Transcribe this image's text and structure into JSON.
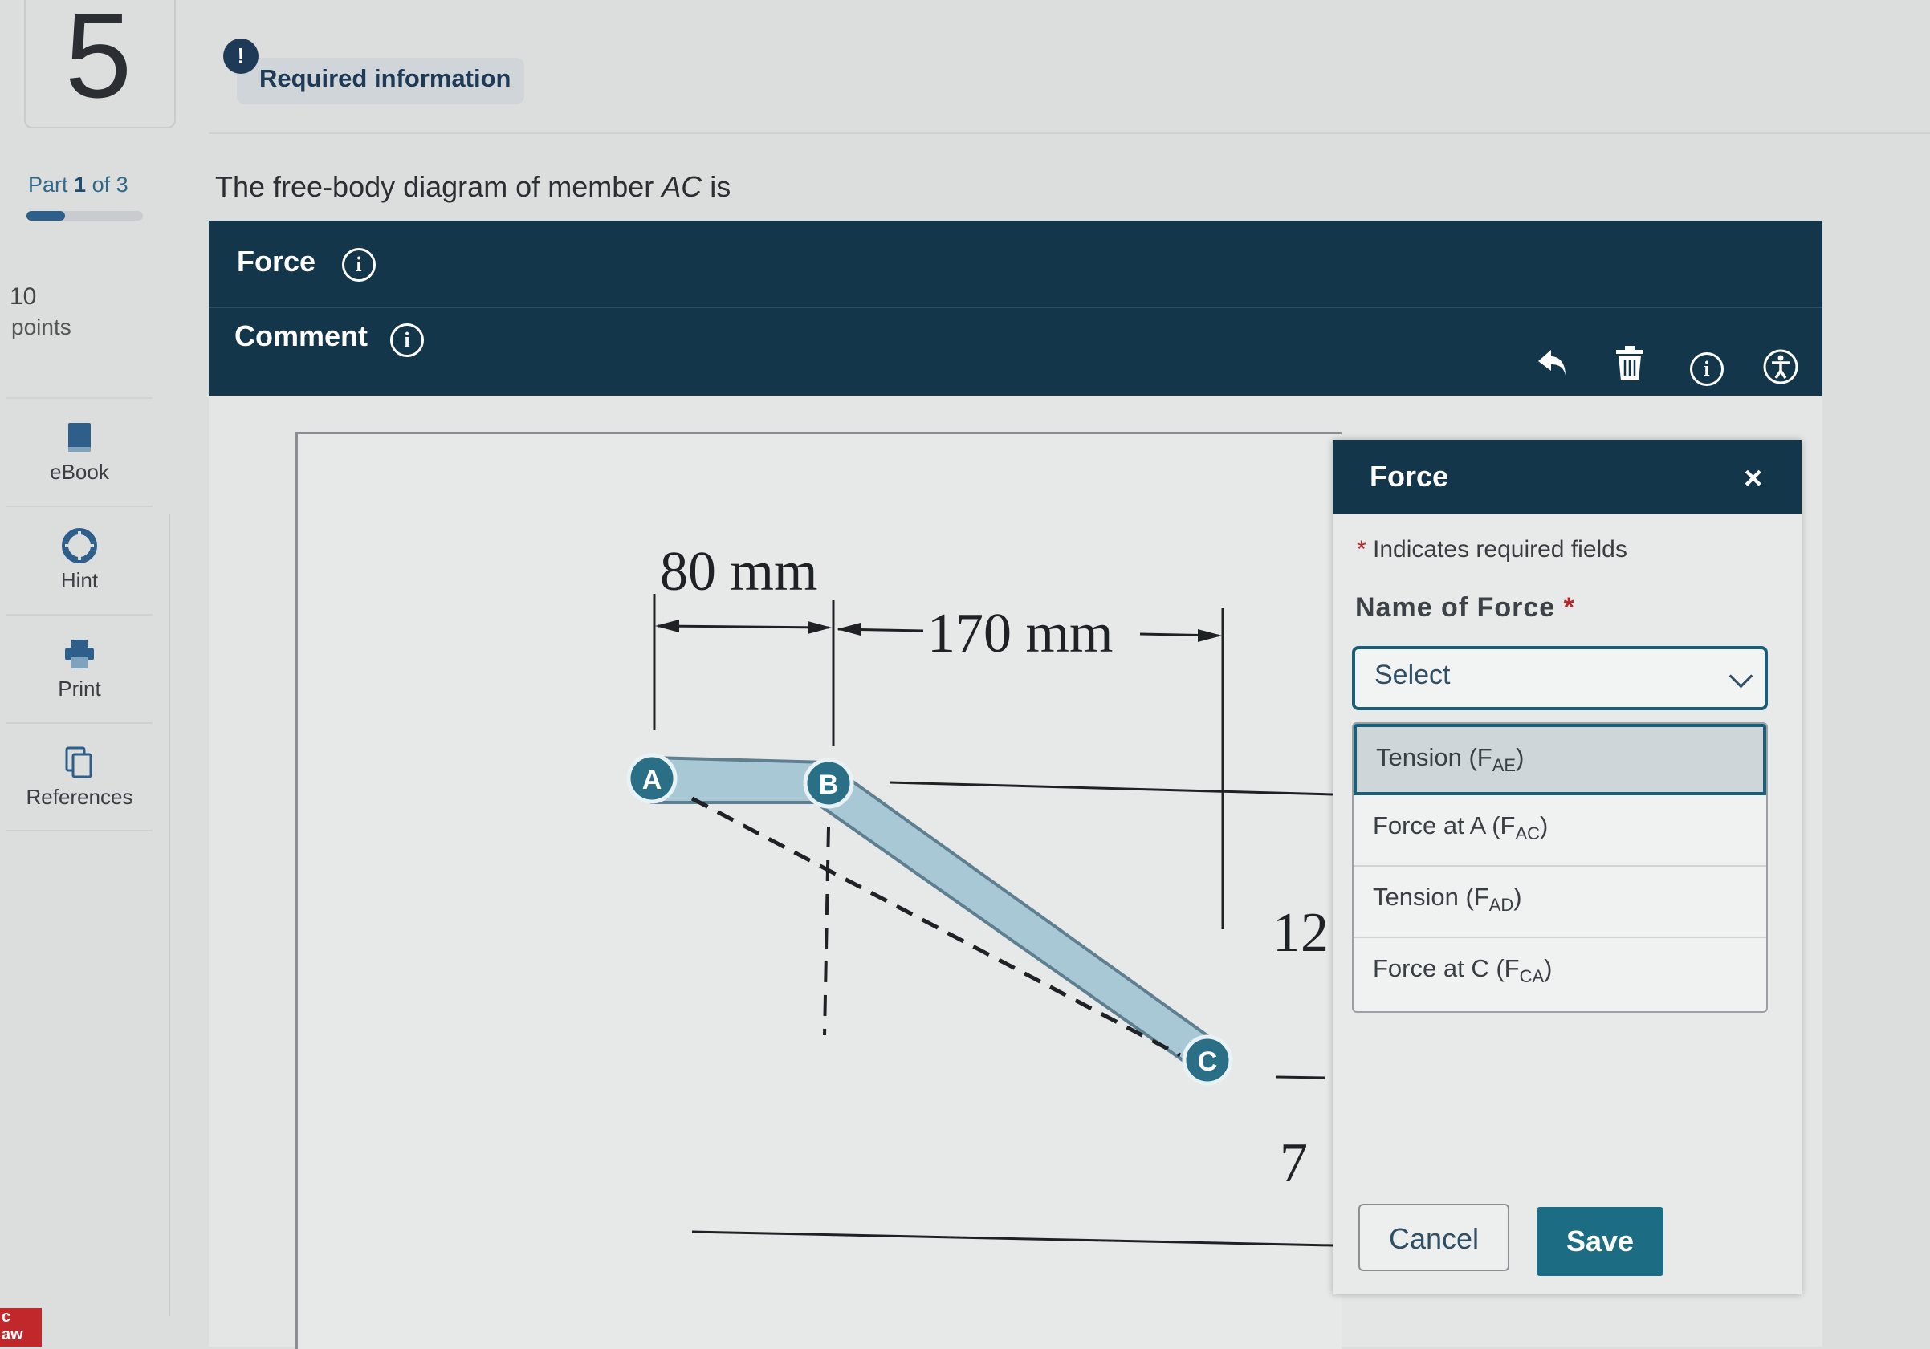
{
  "question": {
    "number": "5"
  },
  "required_info": {
    "label": "Required information",
    "icon": "exclamation-icon"
  },
  "part": {
    "current": "1",
    "of_text": "of",
    "total": "3",
    "progress_fraction": 0.333
  },
  "points": {
    "value": "10",
    "label": "points"
  },
  "sidebar": {
    "items": [
      {
        "label": "eBook",
        "icon": "book-icon"
      },
      {
        "label": "Hint",
        "icon": "lifebuoy-icon"
      },
      {
        "label": "Print",
        "icon": "printer-icon"
      },
      {
        "label": "References",
        "icon": "documents-icon"
      }
    ]
  },
  "prompt": {
    "prefix": "The free-body diagram of member ",
    "member": "AC",
    "suffix": " is"
  },
  "toolbar": {
    "force_label": "Force",
    "comment_label": "Comment",
    "tools": [
      "undo-icon",
      "trash-icon",
      "info-icon",
      "accessibility-icon"
    ]
  },
  "diagram": {
    "dim_left": "80 mm",
    "dim_right": "170 mm",
    "node_a": "A",
    "node_b": "B",
    "node_c": "C",
    "partial_num_1": "12",
    "partial_num_2": "7",
    "member_color": "#a9c8d6",
    "node_color": "#2a6f86"
  },
  "panel": {
    "title": "Force",
    "close_glyph": "×",
    "required_note": "Indicates required fields",
    "name_label": "Name of Force",
    "select_value": "Select",
    "options": [
      {
        "main": "Tension (F",
        "sub": "AE",
        "end": ")"
      },
      {
        "main": "Force at A (F",
        "sub": "AC",
        "end": ")"
      },
      {
        "main": "Tension (F",
        "sub": "AD",
        "end": ")"
      },
      {
        "main": "Force at C (F",
        "sub": "CA",
        "end": ")"
      }
    ],
    "cancel_label": "Cancel",
    "save_label": "Save"
  },
  "corner_tab": {
    "line1": "c",
    "line2": "aw"
  },
  "colors": {
    "toolbar": "#13364b",
    "accent": "#1c6d83",
    "required": "#b8282a"
  }
}
